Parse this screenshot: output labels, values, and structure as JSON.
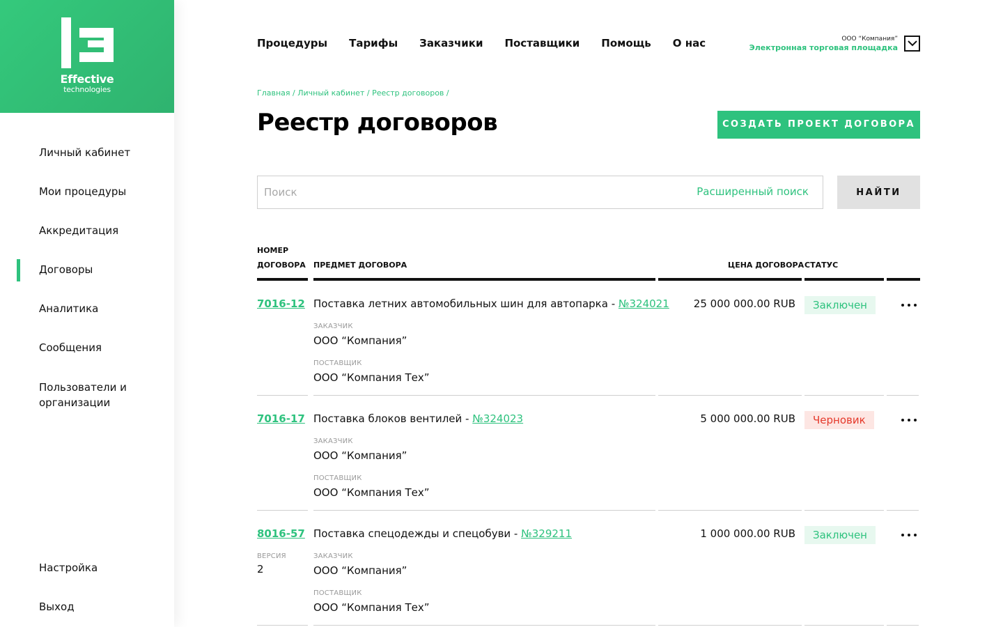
{
  "brand": {
    "line1": "Effective",
    "line2": "technologies"
  },
  "sidebar": {
    "items": [
      {
        "label": "Личный кабинет"
      },
      {
        "label": "Мои процедуры"
      },
      {
        "label": "Аккредитация"
      },
      {
        "label": "Договоры"
      },
      {
        "label": "Аналитика"
      },
      {
        "label": "Сообщения"
      },
      {
        "label": "Пользователи и организации"
      }
    ],
    "active": "Договоры",
    "bottom": [
      {
        "label": "Настройка"
      },
      {
        "label": "Выход"
      }
    ]
  },
  "topnav": [
    "Процедуры",
    "Тарифы",
    "Заказчики",
    "Поставщики",
    "Помощь",
    "О нас"
  ],
  "company": {
    "name": "ООО “Компания”",
    "platform": "Электронная торговая площадка"
  },
  "breadcrumb": [
    "Главная /",
    "Личный кабинет /",
    "Реестр договоров /"
  ],
  "page": {
    "title": "Реестр договоров",
    "create_label": "СОЗДАТЬ ПРОЕКТ ДОГОВОРА"
  },
  "search": {
    "placeholder": "Поиск",
    "advanced": "Расширенный поиск",
    "button": "НАЙТИ"
  },
  "table": {
    "headers": {
      "number_line1": "НОМЕР",
      "number_line2": "ДОГОВОРА",
      "subject": "ПРЕДМЕТ ДОГОВОРА",
      "price": "ЦЕНА ДОГОВОРА",
      "status": "СТАТУС"
    },
    "customer_label": "ЗАКАЗЧИК",
    "supplier_label": "ПОСТАВЩИК",
    "version_label": "ВЕРСИЯ",
    "rows": [
      {
        "number": "7016-12",
        "subject": "Поставка летних автомобильных шин для автопарка - ",
        "procedure": "№324021",
        "customer": "ООО “Компания”",
        "supplier": "ООО “Компания Тех”",
        "price": "25 000 000.00 RUB",
        "status": "Заключен",
        "status_type": "green"
      },
      {
        "number": "7016-17",
        "subject": "Поставка блоков вентилей  - ",
        "procedure": "№324023",
        "customer": "ООО “Компания”",
        "supplier": "ООО “Компания Тех”",
        "price": "5 000 000.00 RUB",
        "status": "Черновик",
        "status_type": "red"
      },
      {
        "number": "8016-57",
        "subject": "Поставка спецодежды и спецобуви - ",
        "procedure": "№329211",
        "customer": "ООО “Компания”",
        "supplier": "ООО “Компания Тех”",
        "price": "1 000 000.00 RUB",
        "status": "Заключен",
        "status_type": "green",
        "version": "2"
      }
    ]
  },
  "colors": {
    "accent": "#2ec27e",
    "draft": "#e5392b"
  }
}
